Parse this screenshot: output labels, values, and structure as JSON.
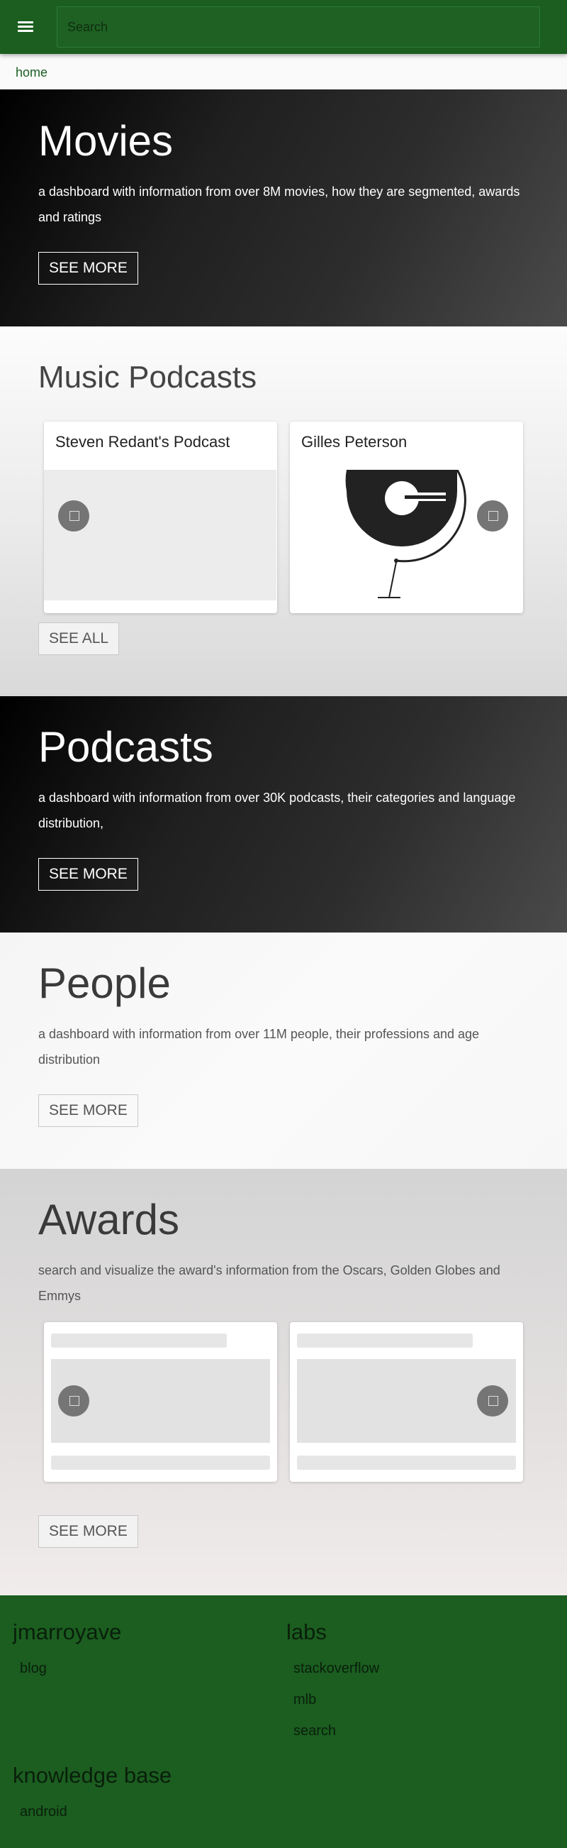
{
  "header": {
    "search_placeholder": "Search",
    "breadcrumb": "home"
  },
  "movies": {
    "title": "Movies",
    "description": "a dashboard with information from over 8M movies, how they are segmented, awards and ratings",
    "button": "SEE MORE"
  },
  "music_podcasts": {
    "title": "Music Podcasts",
    "cards": [
      {
        "title": "Steven Redant's Podcast"
      },
      {
        "title": "Gilles Peterson"
      }
    ],
    "button": "SEE ALL"
  },
  "podcasts": {
    "title": "Podcasts",
    "description": "a dashboard with information from over 30K podcasts, their categories and language distribution,",
    "button": "SEE MORE"
  },
  "people": {
    "title": "People",
    "description": "a dashboard with information from over 11M people, their professions and age distribution",
    "button": "SEE MORE"
  },
  "awards": {
    "title": "Awards",
    "description": "search and visualize the award's information from the Oscars, Golden Globes and Emmys",
    "button": "SEE MORE"
  },
  "footer": {
    "col1_title": "jmarroyave",
    "col1_links": [
      "blog"
    ],
    "col2_title": "labs",
    "col2_links": [
      "stackoverflow",
      "mlb",
      "search"
    ],
    "col3_title": "knowledge base",
    "col3_links": [
      "android"
    ]
  },
  "colors": {
    "primary": "#1b5e20",
    "dark_section": "#000000",
    "placeholder_grey": "#e6e6e6"
  },
  "icons": [
    "menu-icon",
    "play-icon"
  ]
}
